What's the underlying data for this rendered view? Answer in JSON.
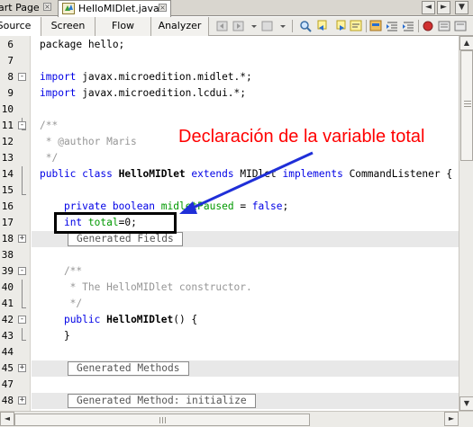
{
  "tabs": {
    "previous_tab": "art Page",
    "active_tab": "HelloMIDlet.java",
    "close_glyph": "×",
    "nav_left": "◄",
    "nav_right": "►",
    "nav_menu": "▼"
  },
  "toolbar": {
    "views": [
      "Source",
      "Screen",
      "Flow",
      "Analyzer"
    ],
    "active_view": "Source",
    "tool_icons": [
      "back-icon",
      "forward-icon",
      "dropdown-icon",
      "find-icon",
      "find-previous-icon",
      "find-next-icon",
      "find-selection-icon",
      "toggle-highlight-icon",
      "shift-left-icon",
      "shift-right-icon",
      "comment-icon",
      "uncomment-icon",
      "record-macro-icon",
      "stop-macro-icon"
    ]
  },
  "editor": {
    "lines": [
      {
        "num": "6",
        "fold": "",
        "parts": [
          {
            "t": "package hello;",
            "c": ""
          }
        ]
      },
      {
        "num": "7",
        "fold": "",
        "parts": []
      },
      {
        "num": "8",
        "fold": "-",
        "parts": [
          {
            "t": "import",
            "c": "kw"
          },
          {
            "t": " javax.microedition.midlet.*;",
            "c": ""
          }
        ]
      },
      {
        "num": "9",
        "fold": "",
        "parts": [
          {
            "t": "import",
            "c": "kw"
          },
          {
            "t": " javax.microedition.lcdui.*;",
            "c": ""
          }
        ]
      },
      {
        "num": "10",
        "fold": "",
        "parts": []
      },
      {
        "num": "11",
        "fold": "-",
        "parts": [
          {
            "t": "/**",
            "c": "cm"
          }
        ]
      },
      {
        "num": "12",
        "fold": "",
        "parts": [
          {
            "t": " * @author Maris",
            "c": "cm"
          }
        ]
      },
      {
        "num": "13",
        "fold": "",
        "parts": [
          {
            "t": " */",
            "c": "cm"
          }
        ]
      },
      {
        "num": "14",
        "fold": "",
        "parts": [
          {
            "t": "public class",
            "c": "kw"
          },
          {
            "t": " ",
            "c": ""
          },
          {
            "t": "HelloMIDlet",
            "c": "cls"
          },
          {
            "t": " ",
            "c": ""
          },
          {
            "t": "extends",
            "c": "kw"
          },
          {
            "t": " MIDlet ",
            "c": ""
          },
          {
            "t": "implements",
            "c": "kw"
          },
          {
            "t": " CommandListener {",
            "c": ""
          }
        ]
      },
      {
        "num": "15",
        "fold": "",
        "parts": []
      },
      {
        "num": "16",
        "fold": "",
        "parts": [
          {
            "t": "    ",
            "c": ""
          },
          {
            "t": "private boolean",
            "c": "kw"
          },
          {
            "t": " ",
            "c": ""
          },
          {
            "t": "midletPaused",
            "c": "fld"
          },
          {
            "t": " = ",
            "c": ""
          },
          {
            "t": "false",
            "c": "kw"
          },
          {
            "t": ";",
            "c": ""
          }
        ]
      },
      {
        "num": "17",
        "fold": "",
        "parts": [
          {
            "t": "    ",
            "c": ""
          },
          {
            "t": "int",
            "c": "kw"
          },
          {
            "t": " ",
            "c": ""
          },
          {
            "t": "total",
            "c": "fld"
          },
          {
            "t": "=0;",
            "c": ""
          }
        ]
      },
      {
        "num": "18",
        "fold": "+",
        "guarded": true,
        "box": "Generated Fields",
        "indent": 4
      },
      {
        "num": "38",
        "fold": "",
        "parts": []
      },
      {
        "num": "39",
        "fold": "-",
        "parts": [
          {
            "t": "    /**",
            "c": "cm"
          }
        ]
      },
      {
        "num": "40",
        "fold": "",
        "parts": [
          {
            "t": "     * The HelloMIDlet constructor.",
            "c": "cm"
          }
        ]
      },
      {
        "num": "41",
        "fold": "",
        "parts": [
          {
            "t": "     */",
            "c": "cm"
          }
        ]
      },
      {
        "num": "42",
        "fold": "-",
        "parts": [
          {
            "t": "    ",
            "c": ""
          },
          {
            "t": "public",
            "c": "kw"
          },
          {
            "t": " ",
            "c": ""
          },
          {
            "t": "HelloMIDlet",
            "c": "cls"
          },
          {
            "t": "() {",
            "c": ""
          }
        ]
      },
      {
        "num": "43",
        "fold": "",
        "parts": [
          {
            "t": "    }",
            "c": ""
          }
        ]
      },
      {
        "num": "44",
        "fold": "",
        "parts": []
      },
      {
        "num": "45",
        "fold": "+",
        "guarded": true,
        "box": "Generated Methods",
        "indent": 4
      },
      {
        "num": "47",
        "fold": "",
        "parts": []
      },
      {
        "num": "48",
        "fold": "+",
        "guarded": true,
        "box": "Generated Method: initialize",
        "indent": 4
      }
    ]
  },
  "annotation": {
    "text": "Declaración de la variable total"
  },
  "scrollbars": {
    "up": "▲",
    "down": "▼",
    "left": "◄",
    "right": "►"
  }
}
